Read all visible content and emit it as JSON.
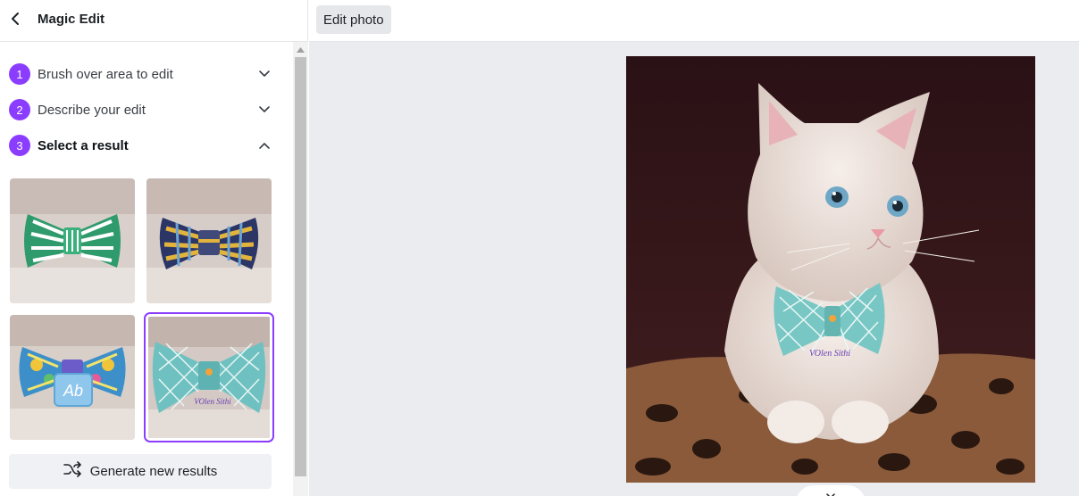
{
  "header": {
    "title": "Magic Edit",
    "back_icon": "chevron-left-icon"
  },
  "steps": [
    {
      "number": "1",
      "label": "Brush over area to edit",
      "state": "collapsed"
    },
    {
      "number": "2",
      "label": "Describe your edit",
      "state": "collapsed"
    },
    {
      "number": "3",
      "label": "Select a result",
      "state": "expanded"
    }
  ],
  "results": [
    {
      "name": "green-striped-bow",
      "selected": false
    },
    {
      "name": "plaid-bow",
      "selected": false
    },
    {
      "name": "patterned-bow",
      "selected": false
    },
    {
      "name": "teal-diamond-bow",
      "selected": true
    }
  ],
  "generate_button": {
    "label": "Generate new results",
    "icon": "shuffle-icon"
  },
  "toolbar": {
    "edit_photo_label": "Edit photo"
  },
  "colors": {
    "accent": "#8b3dff",
    "selected_border": "#8b3dff",
    "canvas_bg": "#ebecf0"
  }
}
